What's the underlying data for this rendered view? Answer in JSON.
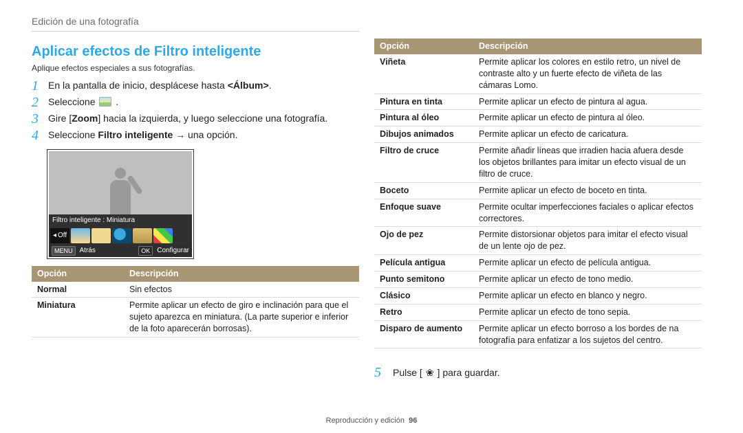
{
  "header": "Edición de una fotografía",
  "title": "Aplicar efectos de Filtro inteligente",
  "intro": "Aplique efectos especiales a sus fotografías.",
  "steps": {
    "s1_pre": "En la pantalla de inicio, desplácese hasta ",
    "s1_album": "<Álbum>",
    "s1_post": ".",
    "s2_pre": "Seleccione ",
    "s2_post": " .",
    "s3_pre": "Gire [",
    "s3_zoom": "Zoom",
    "s3_post": "] hacia la izquierda, y luego seleccione una fotografía.",
    "s4_pre": "Seleccione ",
    "s4_bold": "Filtro inteligente",
    "s4_post": " → una opción."
  },
  "screenshot": {
    "label": "Filtro inteligente : Miniatura",
    "off": "Off",
    "menu": "MENU",
    "back": "Atrás",
    "ok": "OK",
    "config": "Configurar"
  },
  "table_head": {
    "opt": "Opción",
    "desc": "Descripción"
  },
  "left_rows": [
    {
      "opt": "Normal",
      "desc": "Sin efectos"
    },
    {
      "opt": "Miniatura",
      "desc": "Permite aplicar un efecto de giro e inclinación para que el sujeto aparezca en miniatura. (La parte superior e inferior de la foto aparecerán borrosas)."
    }
  ],
  "right_rows": [
    {
      "opt": "Viñeta",
      "desc": "Permite aplicar los colores en estilo retro, un nivel de contraste alto y un fuerte efecto de viñeta de las cámaras Lomo."
    },
    {
      "opt": "Pintura en tinta",
      "desc": "Permite aplicar un efecto de pintura al agua."
    },
    {
      "opt": "Pintura al óleo",
      "desc": "Permite aplicar un efecto de pintura al óleo."
    },
    {
      "opt": "Dibujos animados",
      "desc": "Permite aplicar un efecto de caricatura."
    },
    {
      "opt": "Filtro de cruce",
      "desc": "Permite añadir líneas que irradien hacia afuera desde los objetos brillantes para imitar un efecto visual de un filtro de cruce."
    },
    {
      "opt": "Boceto",
      "desc": "Permite aplicar un efecto de boceto en tinta."
    },
    {
      "opt": "Enfoque suave",
      "desc": "Permite ocultar imperfecciones faciales o aplicar efectos correctores."
    },
    {
      "opt": "Ojo de pez",
      "desc": "Permite distorsionar objetos para imitar el efecto visual de un lente ojo de pez."
    },
    {
      "opt": "Película antigua",
      "desc": "Permite aplicar un efecto de película antigua."
    },
    {
      "opt": "Punto semitono",
      "desc": "Permite aplicar un efecto de tono medio."
    },
    {
      "opt": "Clásico",
      "desc": "Permite aplicar un efecto en blanco y negro."
    },
    {
      "opt": "Retro",
      "desc": "Permite aplicar un efecto de tono sepia."
    },
    {
      "opt": "Disparo de aumento",
      "desc": "Permite aplicar un efecto borroso a los bordes de na fotografía para enfatizar a los sujetos del centro."
    }
  ],
  "step5_pre": "Pulse [",
  "step5_post": "] para guardar.",
  "footer_text": "Reproducción y edición",
  "footer_page": "96"
}
